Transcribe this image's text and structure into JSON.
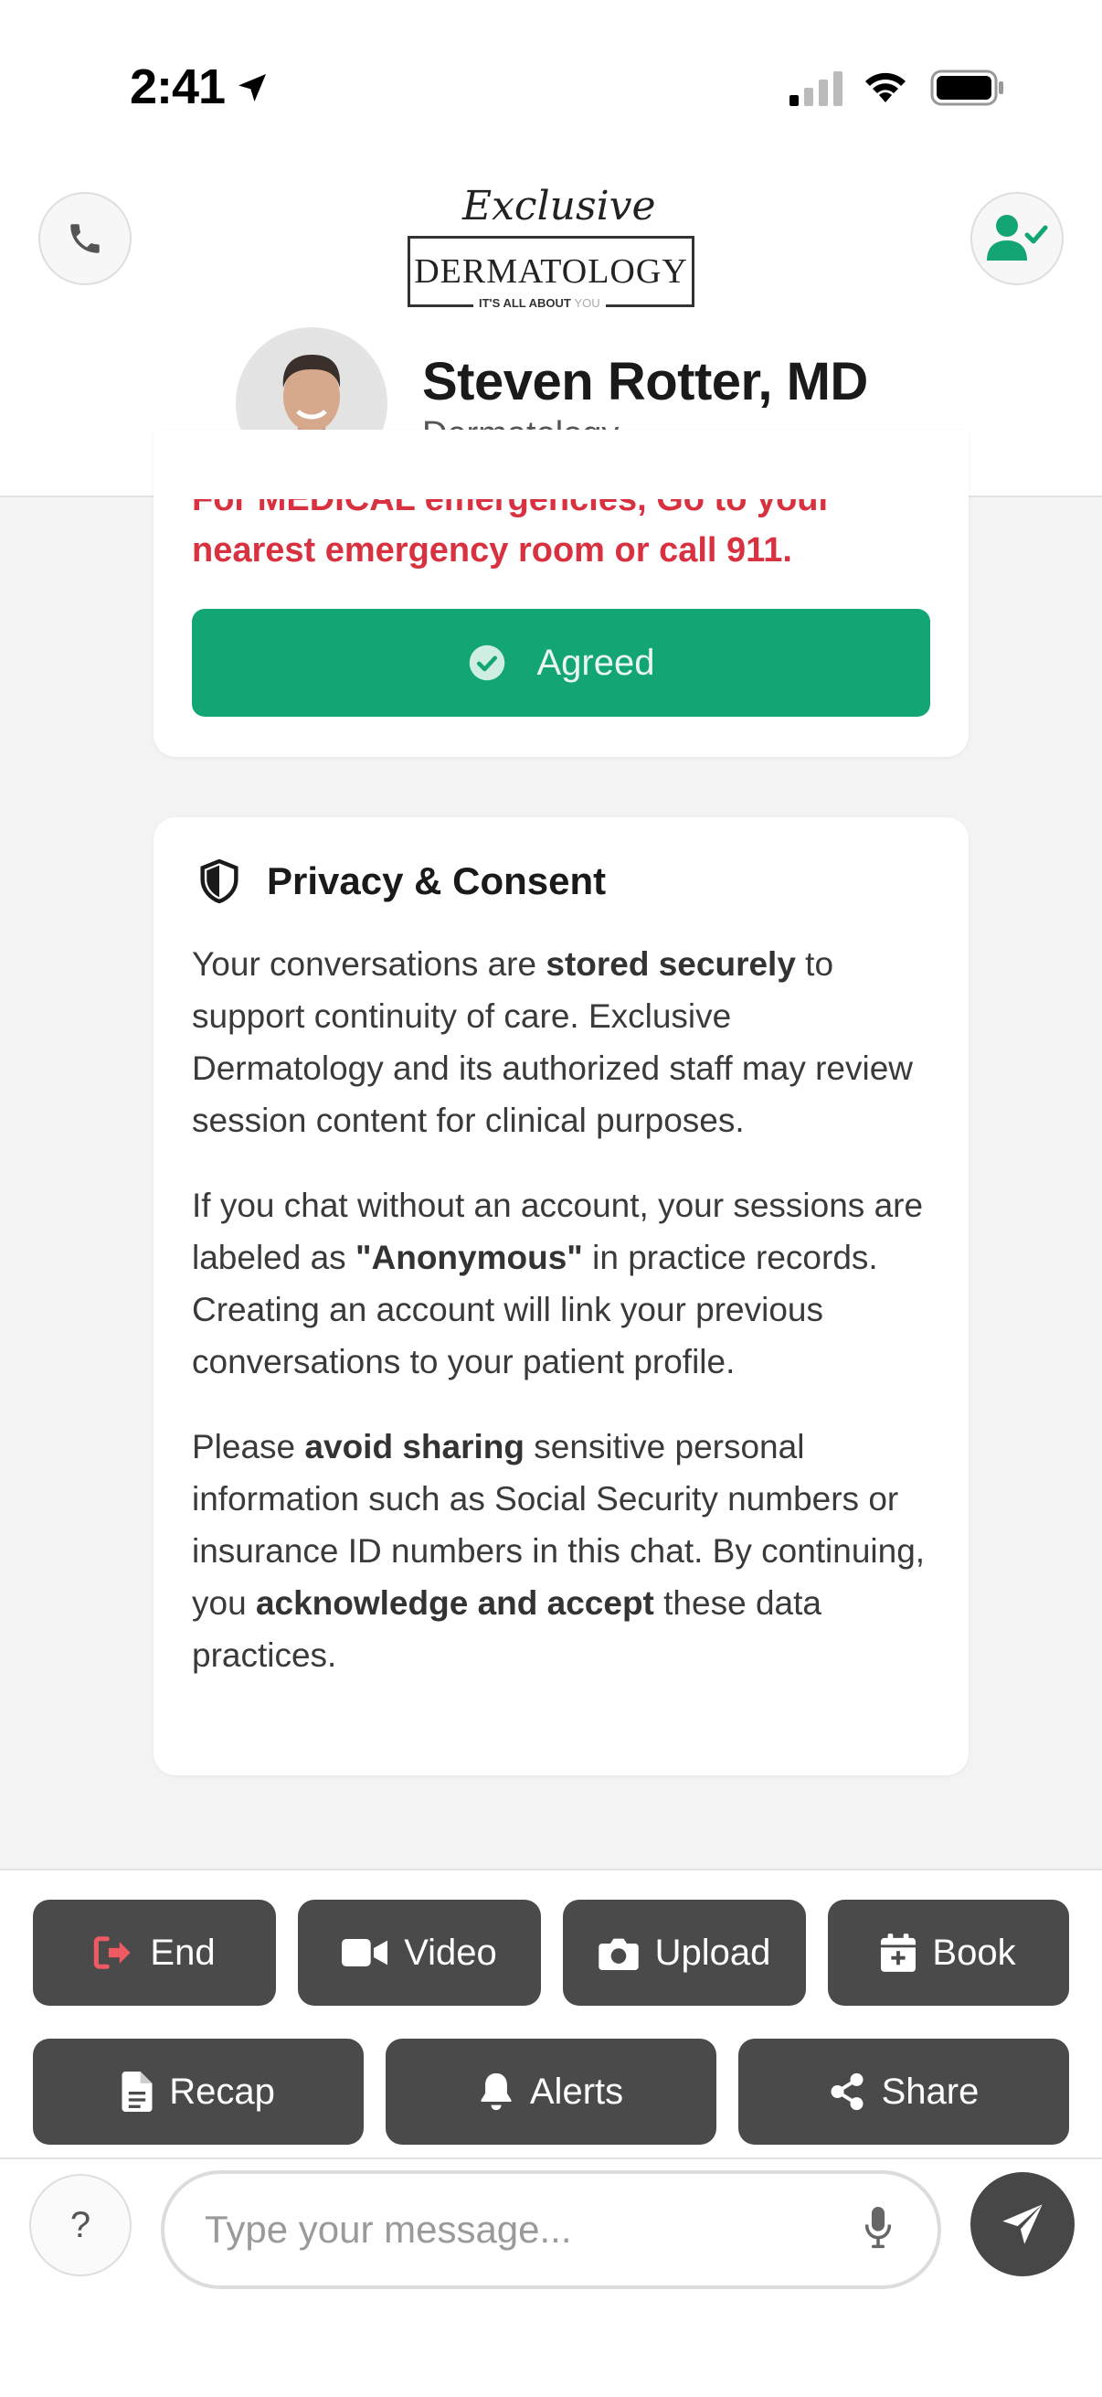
{
  "status_bar": {
    "time": "2:41"
  },
  "header": {
    "logo": {
      "script": "Exclusive",
      "main": "DERMATOLOGY",
      "tagline": "IT'S ALL ABOUT",
      "tagline_you": "YOU"
    },
    "doctor_name": "Steven Rotter, MD",
    "specialty": "Dermatology"
  },
  "emergency": {
    "text_partial": "For MEDICAL emergencies, Go to your",
    "text": "nearest emergency room or call 911.",
    "agreed_label": "Agreed"
  },
  "privacy": {
    "title": "Privacy & Consent",
    "p1": {
      "a": "Your conversations are ",
      "b": "stored securely",
      "c": " to support continuity of care. Exclusive Dermatology and its authorized staff may review session content for clinical purposes."
    },
    "p2": {
      "a": "If you chat without an account, your sessions are labeled as ",
      "b": "\"Anonymous\"",
      "c": " in practice records. Creating an account will link your previous conversations to your patient profile."
    },
    "p3": {
      "a": "Please ",
      "b": "avoid sharing",
      "c": " sensitive personal information such as Social Security numbers or insurance ID numbers in this chat. By continuing, you ",
      "d": "acknowledge and accept",
      "e": " these data practices."
    }
  },
  "actions": {
    "end": "End",
    "video": "Video",
    "upload": "Upload",
    "book": "Book",
    "recap": "Recap",
    "alerts": "Alerts",
    "share": "Share"
  },
  "composer": {
    "help": "?",
    "placeholder": "Type your message..."
  },
  "colors": {
    "accent_green": "#13a574",
    "emergency_red": "#d8313f",
    "action_button": "#4a4a4a",
    "end_icon": "#ef5a63"
  }
}
